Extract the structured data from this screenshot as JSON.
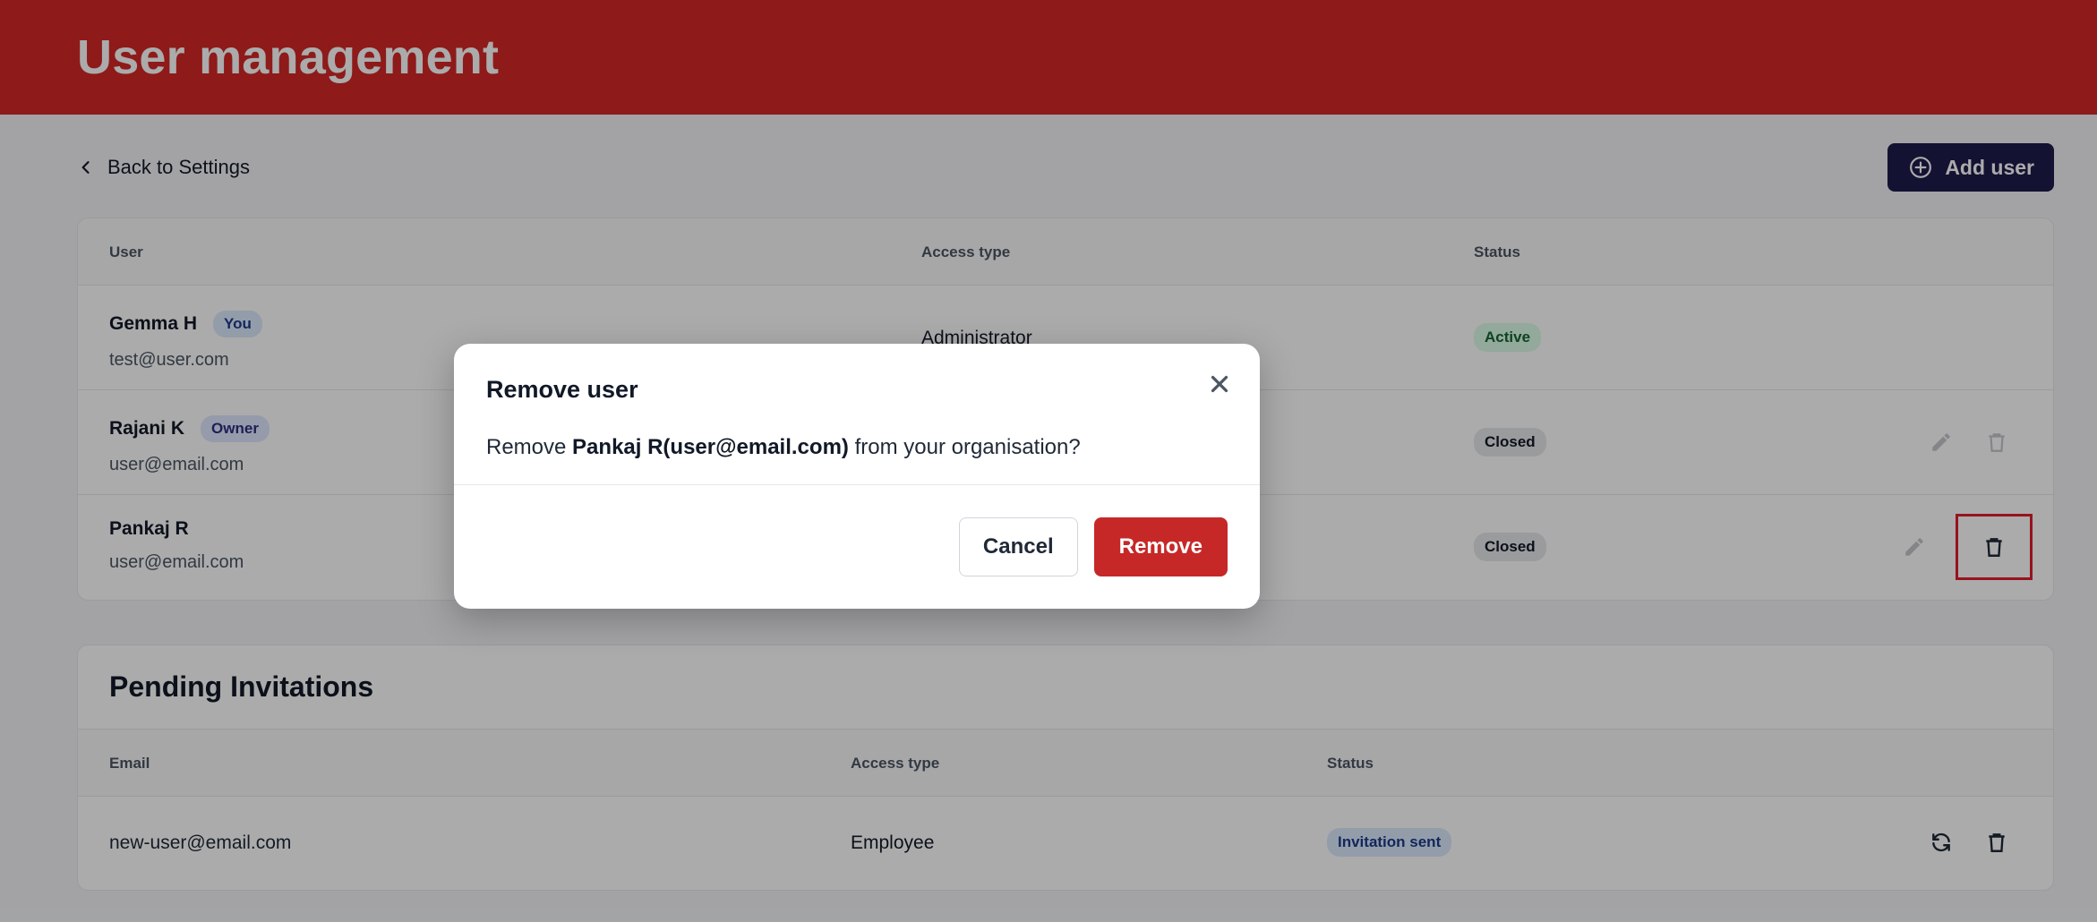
{
  "header": {
    "title": "User management"
  },
  "toolbar": {
    "back_label": "Back to Settings",
    "add_user_label": "Add user"
  },
  "users_table": {
    "columns": [
      "User",
      "Access type",
      "Status"
    ],
    "rows": [
      {
        "name": "Gemma H",
        "tag": "You",
        "email": "test@user.com",
        "access": "Administrator",
        "status": "Active"
      },
      {
        "name": "Rajani K",
        "tag": "Owner",
        "email": "user@email.com",
        "access": "",
        "status": "Closed"
      },
      {
        "name": "Pankaj R",
        "tag": "",
        "email": "user@email.com",
        "access": "",
        "status": "Closed"
      }
    ]
  },
  "pending": {
    "title": "Pending Invitations",
    "columns": [
      "Email",
      "Access type",
      "Status"
    ],
    "rows": [
      {
        "email": "new-user@email.com",
        "access": "Employee",
        "status": "Invitation sent"
      }
    ]
  },
  "modal": {
    "title": "Remove user",
    "message_prefix": "Remove ",
    "message_bold": "Pankaj R(user@email.com)",
    "message_suffix": " from your organisation?",
    "cancel_label": "Cancel",
    "remove_label": "Remove"
  },
  "colors": {
    "header": "#d42727",
    "primary_button": "#1e1b4b",
    "danger": "#c62828",
    "highlight": "#e11d2e"
  }
}
